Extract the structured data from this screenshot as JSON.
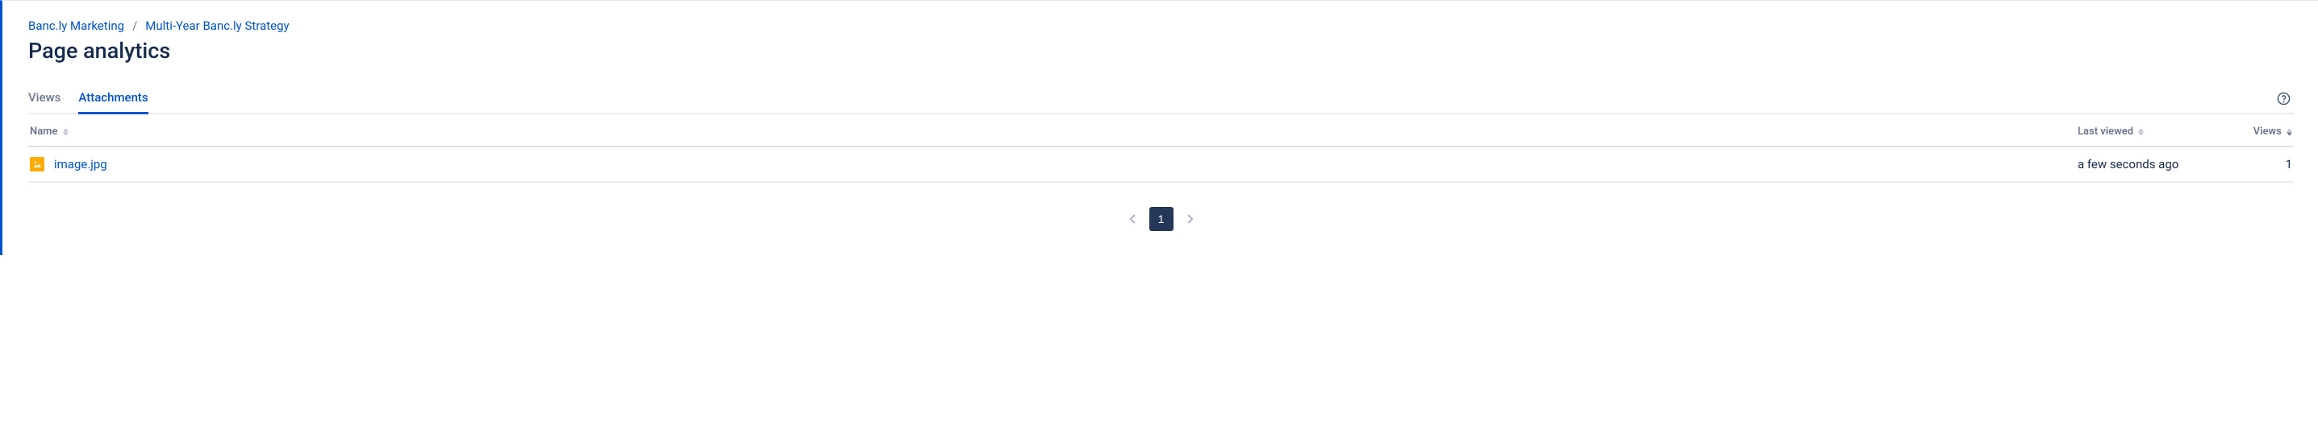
{
  "breadcrumb": {
    "items": [
      {
        "label": "Banc.ly Marketing"
      },
      {
        "label": "Multi-Year Banc.ly Strategy"
      }
    ],
    "separator": "/"
  },
  "page_title": "Page analytics",
  "tabs": {
    "views": "Views",
    "attachments": "Attachments"
  },
  "table": {
    "headers": {
      "name": "Name",
      "last_viewed": "Last viewed",
      "views": "Views"
    },
    "rows": [
      {
        "icon": "image-file-icon",
        "name": "image.jpg",
        "last_viewed": "a few seconds ago",
        "views": "1"
      }
    ]
  },
  "pagination": {
    "current": "1"
  }
}
